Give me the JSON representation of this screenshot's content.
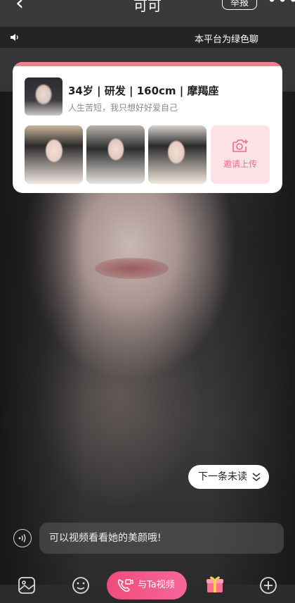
{
  "header": {
    "back_icon": "chevron-left-icon",
    "title": "可可",
    "report_label": "举报",
    "more_icon": "more-dots-icon"
  },
  "notice": {
    "icon": "speaker-icon",
    "text": "本平台为绿色聊"
  },
  "profile": {
    "info": "34岁 | 研发 | 160cm | 摩羯座",
    "motto": "人生苦短，我只想好好爱自己",
    "photos": [
      "photo-1",
      "photo-2",
      "photo-3"
    ],
    "invite_label": "邀请上传",
    "invite_icon": "camera-plus-icon"
  },
  "next_unread": {
    "label": "下一条未读",
    "icon": "double-chevron-down-icon"
  },
  "composer": {
    "voice_icon": "voice-wave-icon",
    "text": "可以视频看看她的美颜哦!"
  },
  "toolbar": {
    "sticker_icon": "sticker-icon",
    "emoji_icon": "smile-icon",
    "video_label": "与Ta视频",
    "video_icon": "video-call-icon",
    "gift_icon": "gift-icon",
    "plus_icon": "plus-circle-icon"
  },
  "colors": {
    "accent_pink": "#f04c7a",
    "invite_bg": "#fde2e8",
    "invite_text": "#f06d84",
    "card_top_band": "#f27e90"
  }
}
